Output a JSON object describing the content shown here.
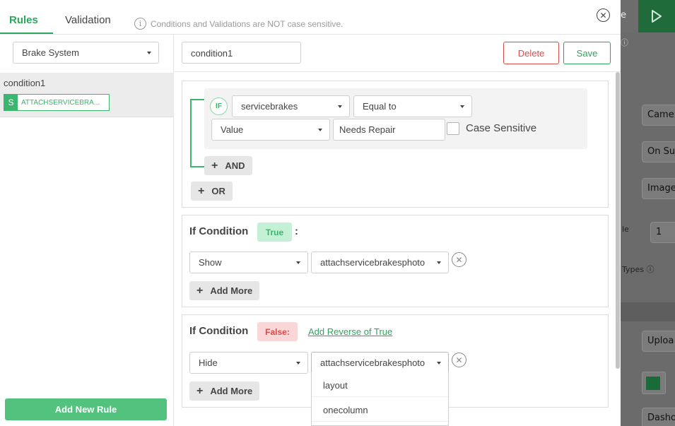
{
  "background_app": {
    "partial_label_top": "e",
    "field_1": "Camer",
    "field_2": "On Sul",
    "field_3": "Image",
    "label_le": "le",
    "field_num": "1",
    "label_types": "Types ⓘ",
    "field_upload": "Uploa",
    "field_dash": "Dasho"
  },
  "header": {
    "tabs": [
      {
        "label": "Rules",
        "active": true
      },
      {
        "label": "Validation",
        "active": false
      }
    ],
    "info_text": "Conditions and Validations are NOT case sensitive."
  },
  "left_panel": {
    "category_select": "Brake System",
    "rules": [
      {
        "name": "condition1",
        "tag_letter": "S",
        "tag_text": "ATTACHSERVICEBRA..."
      }
    ],
    "add_rule_label": "Add New Rule"
  },
  "rule_editor": {
    "condition_name": "condition1",
    "delete_label": "Delete",
    "save_label": "Save",
    "if_block": {
      "if_badge": "IF",
      "field_select": "servicebrakes",
      "operator_select": "Equal to",
      "value_type_select": "Value",
      "value_input": "Needs Repair",
      "case_sensitive_label": "Case Sensitive",
      "case_sensitive_checked": false,
      "and_label": "AND",
      "or_label": "OR"
    },
    "true_block": {
      "title": "If Condition",
      "badge": "True",
      "colon": ":",
      "action_select": "Show",
      "target_select": "attachservicebrakesphoto",
      "add_more_label": "Add More"
    },
    "false_block": {
      "title": "If Condition",
      "badge": "False:",
      "reverse_link": "Add Reverse of True",
      "action_select": "Hide",
      "target_select": "attachservicebrakesphoto",
      "add_more_label": "Add More",
      "dropdown_options": [
        "layout",
        "onecolumn"
      ]
    }
  },
  "colors": {
    "accent_green": "#2ea55f",
    "danger_red": "#d94c4c",
    "add_rule_green": "#53c27f"
  }
}
